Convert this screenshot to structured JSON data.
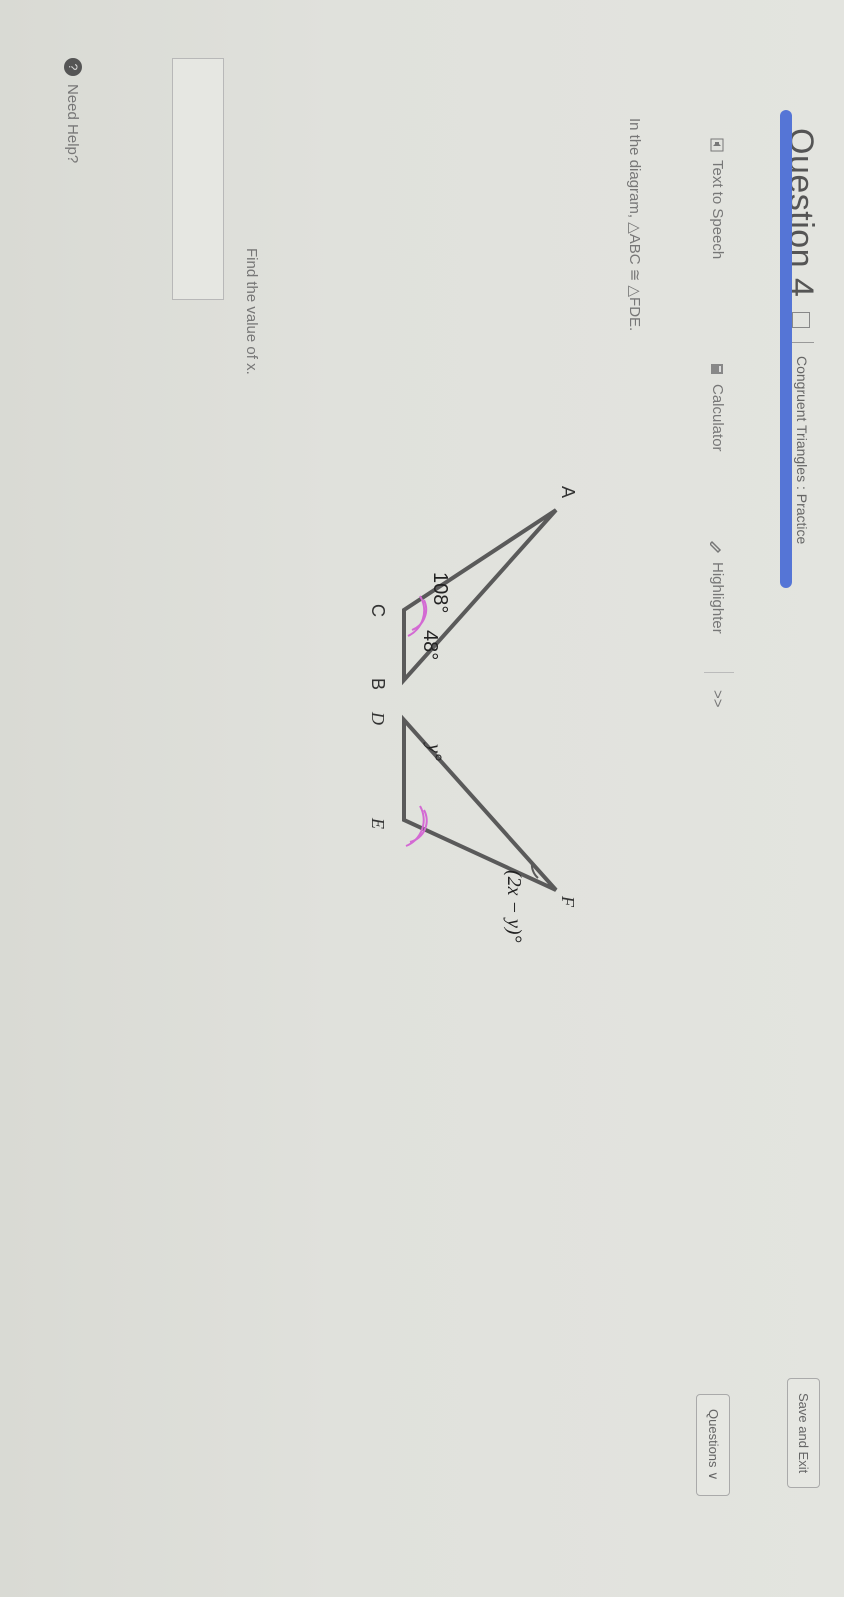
{
  "header": {
    "question_title": "Question 4",
    "breadcrumb": "Congruent Triangles : Practice",
    "save_exit": "Save and Exit",
    "questions_button": "Questions"
  },
  "toolbar": {
    "text_to_speech": "Text to Speech",
    "calculator": "Calculator",
    "highlighter": "Highlighter",
    "more": ">>"
  },
  "problem": {
    "statement": "In the diagram, △ABC ≅ △FDE.",
    "question": "Find the value of x."
  },
  "diagram": {
    "labels": {
      "A": "A",
      "B": "B",
      "C": "C",
      "D": "D",
      "E": "E",
      "F": "F",
      "angle_c": "108°",
      "angle_b": "48°",
      "angle_d": "y°",
      "angle_f": "(2x − y)°"
    },
    "line_color": "#5a5a5a",
    "arc_color": "#d36ad3"
  },
  "help": {
    "label": "Need Help?"
  }
}
